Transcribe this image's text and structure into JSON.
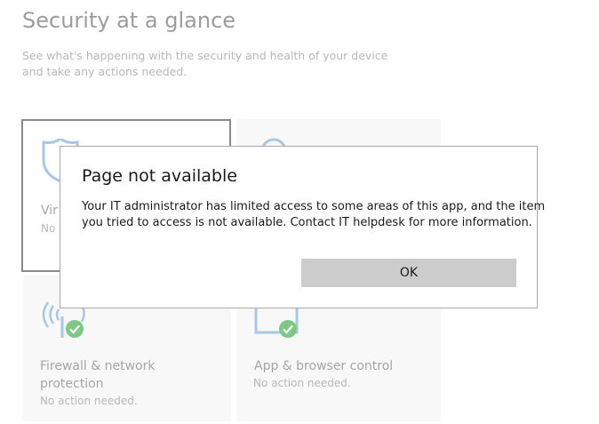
{
  "header": {
    "title": "Security at a glance",
    "subtitle_line1": "See what's happening with the security and health of your device",
    "subtitle_line2": "and take any actions needed."
  },
  "tiles": [
    {
      "title_line1": "Vir",
      "title_line2": "",
      "status": "No a",
      "icon": "shield-icon",
      "selected": true
    },
    {
      "title_line1": "",
      "title_line2": "",
      "status": "",
      "icon": "person-icon",
      "selected": false
    },
    {
      "title_line1": "Firewall & network",
      "title_line2": "protection",
      "status": "No action needed.",
      "icon": "wifi-icon"
    },
    {
      "title_line1": "App & browser control",
      "title_line2": "",
      "status": "No action needed.",
      "icon": "browser-window-icon"
    }
  ],
  "dialog": {
    "title": "Page not available",
    "message_line1": "Your IT administrator has limited access to some areas of this app, and the item",
    "message_line2": "you tried to access is not available. Contact IT helpdesk for more information.",
    "ok_label": "OK"
  },
  "colors": {
    "check_green": "#7fc883",
    "icon_blue": "#a7c7e7",
    "dialog_button": "#cccccc"
  }
}
